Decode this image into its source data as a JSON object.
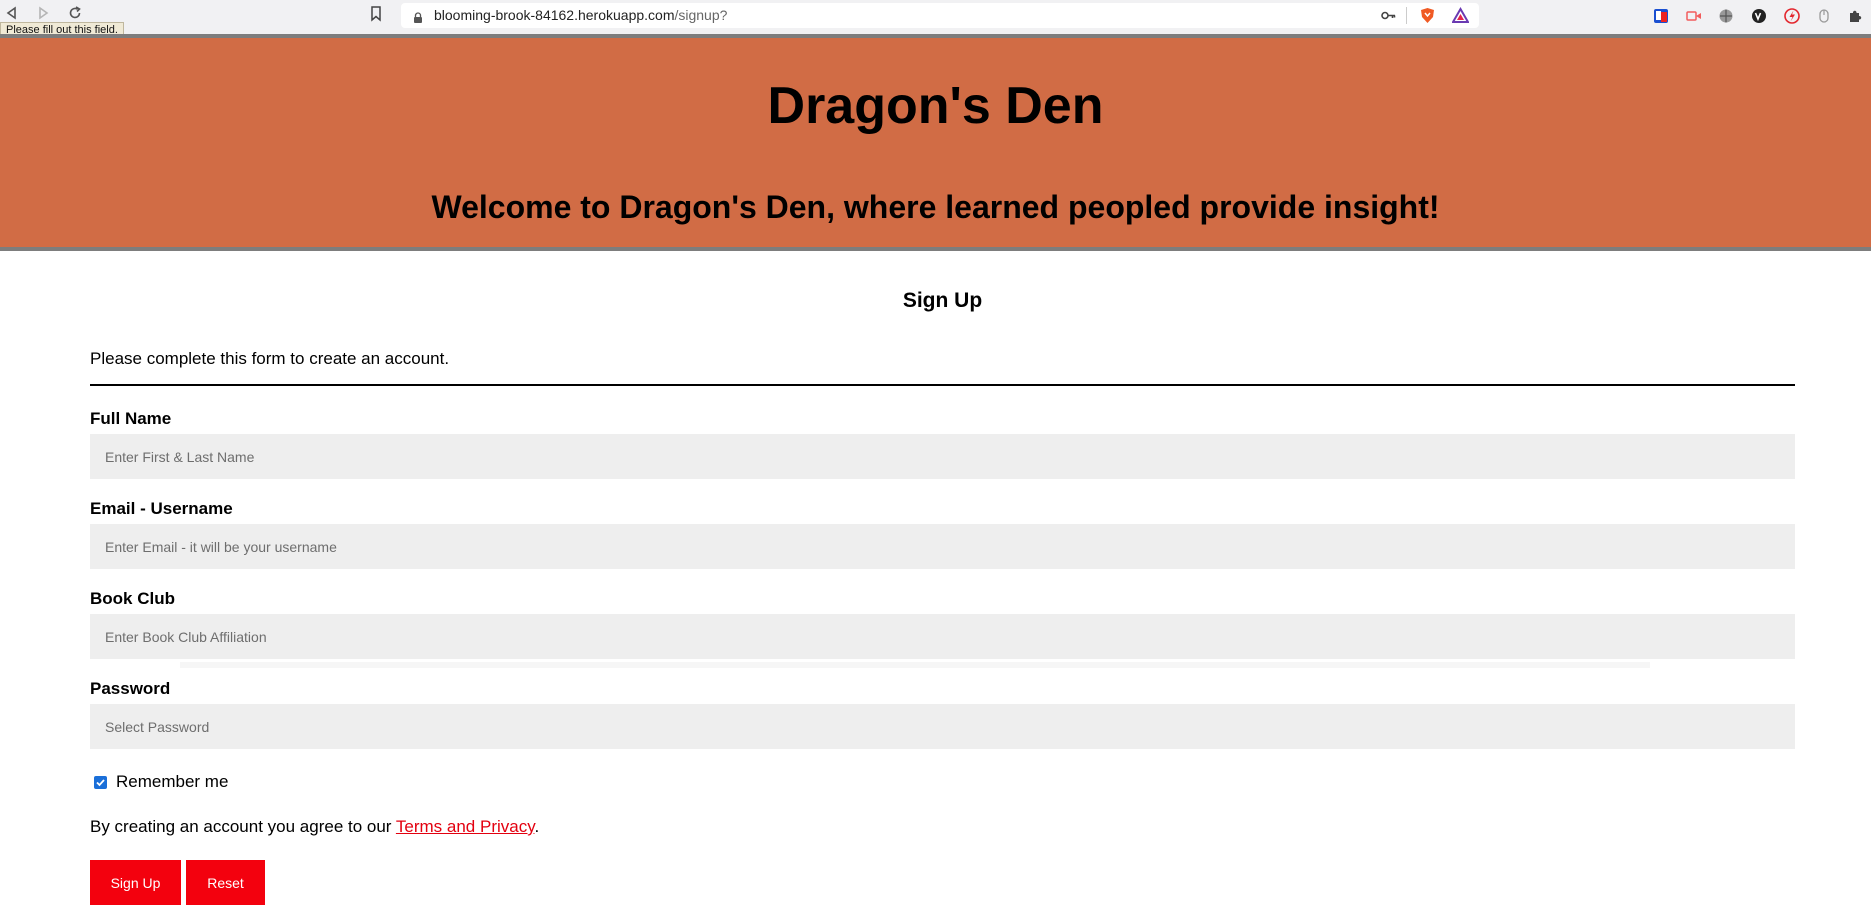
{
  "browser": {
    "url_host": "blooming-brook-84162.herokuapp.com",
    "url_path": "/signup?",
    "tooltip": "Please fill out this field."
  },
  "header": {
    "title": "Dragon's Den",
    "subtitle": "Welcome to Dragon's Den, where learned peopled provide insight!"
  },
  "form": {
    "heading": "Sign Up",
    "intro": "Please complete this form to create an account.",
    "fields": [
      {
        "label": "Full Name",
        "placeholder": "Enter First & Last Name",
        "value": ""
      },
      {
        "label": "Email - Username",
        "placeholder": "Enter Email - it will be your username",
        "value": ""
      },
      {
        "label": "Book Club",
        "placeholder": "Enter Book Club Affiliation",
        "value": ""
      },
      {
        "label": "Password",
        "placeholder": "Select Password",
        "value": ""
      }
    ],
    "remember_label": "Remember me",
    "remember_checked": true,
    "terms_prefix": "By creating an account you agree to our ",
    "terms_link": "Terms and Privacy",
    "terms_suffix": ".",
    "signup_label": "Sign Up",
    "reset_label": "Reset"
  },
  "colors": {
    "banner": "#d16c45",
    "button": "#f3010e",
    "link": "#e3000f",
    "input_bg": "#eeeeee"
  }
}
